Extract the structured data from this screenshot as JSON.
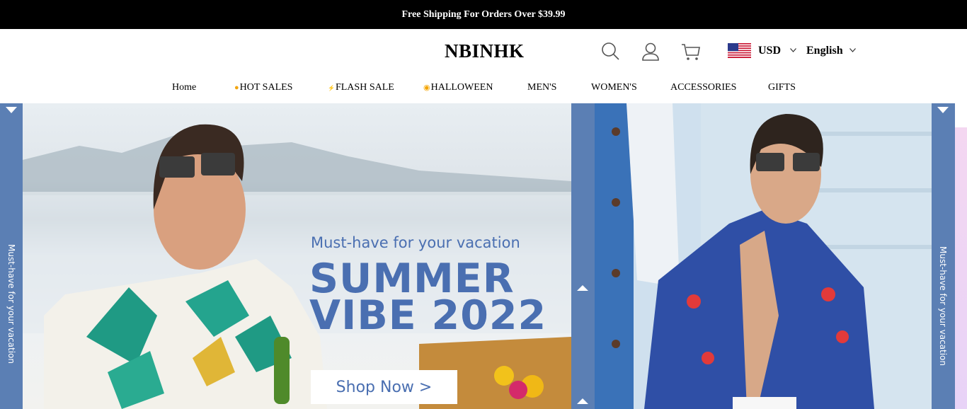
{
  "announcement": "Free Shipping For Orders Over $39.99",
  "header": {
    "logo": "NBINHK",
    "currency": "USD",
    "language": "English",
    "icons": [
      "search-icon",
      "user-icon",
      "cart-icon",
      "us-flag-icon"
    ]
  },
  "nav": [
    {
      "label": "Home",
      "icon": ""
    },
    {
      "label": "HOT SALES",
      "icon": "hot-icon"
    },
    {
      "label": "FLASH SALE",
      "icon": "flash-icon"
    },
    {
      "label": "HALLOWEEN",
      "icon": "pumpkin-icon"
    },
    {
      "label": "MEN'S",
      "icon": ""
    },
    {
      "label": "WOMEN'S",
      "icon": ""
    },
    {
      "label": "ACCESSORIES",
      "icon": ""
    },
    {
      "label": "GIFTS",
      "icon": ""
    }
  ],
  "banner": {
    "side_tab_text": "Must-have for your vacation",
    "subtitle": "Must-have for your vacation",
    "title_line1": "SUMMER",
    "title_line2": "VIBE 2022",
    "cta": "Shop Now >",
    "accent_color": "#4a6fb1",
    "tab_color": "#5b7fb4"
  }
}
